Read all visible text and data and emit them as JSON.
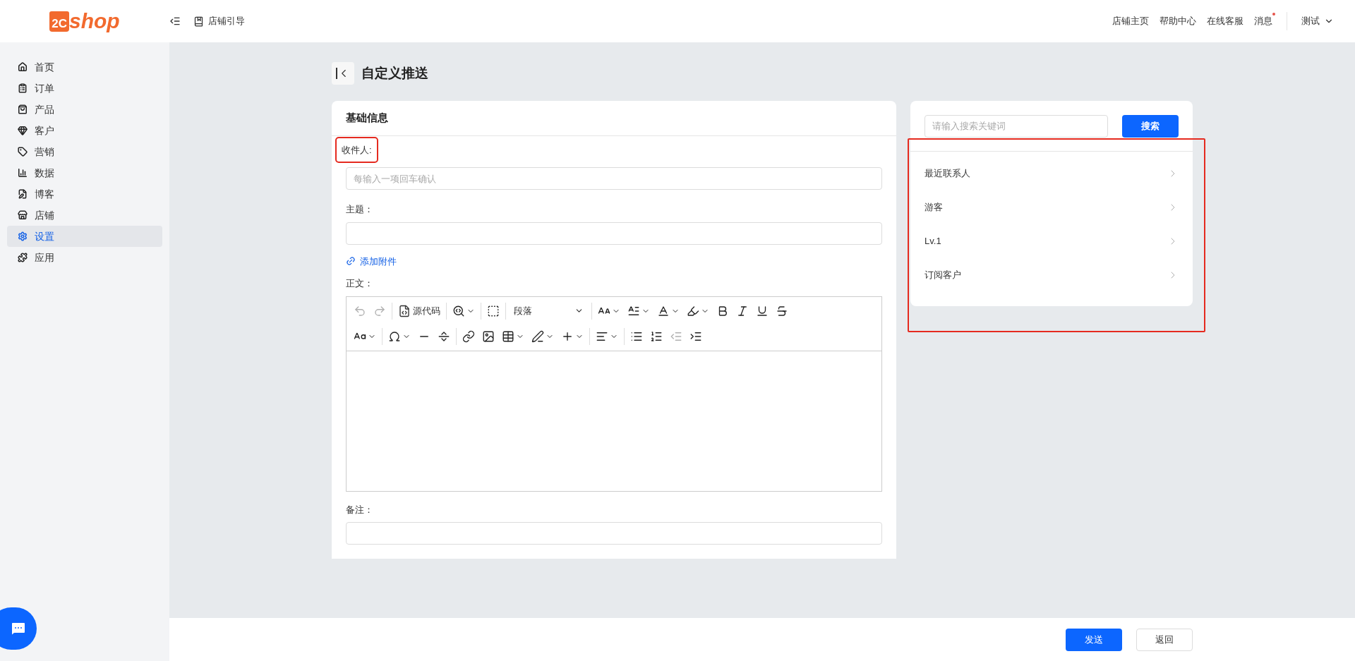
{
  "header": {
    "logo": {
      "mark": "2C",
      "text": "shop"
    },
    "guide_link": "店铺引导",
    "links": [
      "店铺主页",
      "帮助中心",
      "在线客服"
    ],
    "messages": {
      "label": "消息",
      "unread": true
    },
    "user": "测试"
  },
  "sidebar": {
    "items": [
      {
        "label": "首页",
        "selected": false
      },
      {
        "label": "订单",
        "selected": false
      },
      {
        "label": "产品",
        "selected": false
      },
      {
        "label": "客户",
        "selected": false
      },
      {
        "label": "营销",
        "selected": false
      },
      {
        "label": "数据",
        "selected": false
      },
      {
        "label": "博客",
        "selected": false
      },
      {
        "label": "店铺",
        "selected": false
      },
      {
        "label": "设置",
        "selected": true
      },
      {
        "label": "应用",
        "selected": false
      }
    ]
  },
  "page_title": "自定义推送",
  "form": {
    "title": "基础信息",
    "recipient": {
      "label": "收件人:",
      "placeholder": "每输入一项回车确认",
      "highlighted": true
    },
    "subject": {
      "label": "主题："
    },
    "attachment_link": "添加附件",
    "body": {
      "label": "正文：",
      "source_code": "源代码",
      "block_format": "段落",
      "undo_disabled": true,
      "redo_disabled": true,
      "outdent_disabled": true
    },
    "note": {
      "label": "备注："
    }
  },
  "contacts": {
    "search_placeholder": "请输入搜索关键词",
    "search_button": "搜索",
    "highlighted": true,
    "groups": [
      "最近联系人",
      "游客",
      "Lv.1",
      "订阅客户"
    ]
  },
  "footer": {
    "send": "发送",
    "back": "返回"
  }
}
